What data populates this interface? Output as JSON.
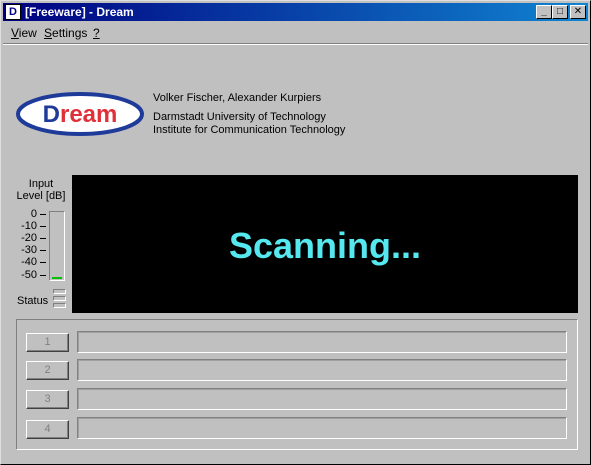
{
  "window": {
    "title": "[Freeware] - Dream",
    "app_icon_glyph": "D"
  },
  "title_buttons": {
    "minimize": "_",
    "maximize": "□",
    "close": "✕"
  },
  "menu": {
    "items": [
      {
        "label": "View",
        "accel": "V",
        "rest": "iew"
      },
      {
        "label": "Settings",
        "accel": "S",
        "rest": "ettings"
      },
      {
        "label": "?",
        "accel": "?",
        "rest": ""
      }
    ]
  },
  "logo": {
    "text": "Dream",
    "brand_color_dark": "#1f3b99",
    "brand_color_red": "#e0303a"
  },
  "info": {
    "authors": "Volker Fischer, Alexander Kurpiers",
    "university": "Darmstadt University of Technology",
    "institute": "Institute for Communication Technology"
  },
  "input_level": {
    "label_line1": "Input",
    "label_line2": "Level [dB]",
    "ticks": [
      "0",
      "-10",
      "-20",
      "-30",
      "-40",
      "-50"
    ],
    "value_db": -50,
    "fill_color": "#00c000"
  },
  "status": {
    "label": "Status"
  },
  "display": {
    "text": "Scanning...",
    "text_color": "#55e8ee",
    "background": "#000000"
  },
  "services": [
    {
      "label": "1",
      "value": ""
    },
    {
      "label": "2",
      "value": ""
    },
    {
      "label": "3",
      "value": ""
    },
    {
      "label": "4",
      "value": ""
    }
  ]
}
